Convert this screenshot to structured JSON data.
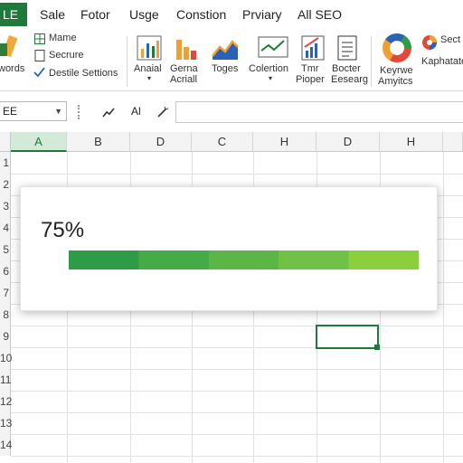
{
  "menubar": {
    "file_tab": "LE",
    "items": [
      "Sale",
      "Fotor",
      "Usge",
      "Constion",
      "Prviary",
      "All SEO"
    ]
  },
  "ribbon": {
    "left_label": "words",
    "group_items": [
      "Mame",
      "Secrure",
      "Destile Settions"
    ],
    "tools": [
      {
        "label": "Anaial",
        "sub": "▾",
        "icon": "line-chart-icon"
      },
      {
        "label": "Gerna",
        "sub": "Acriall",
        "icon": "bar-chart-icon"
      },
      {
        "label": "Toges",
        "sub": "",
        "icon": "area-chart-icon"
      },
      {
        "label": "Colertion",
        "sub": "▾",
        "icon": "trend-chart-icon"
      },
      {
        "label": "Tmr",
        "sub": "Pioper",
        "icon": "growth-chart-icon"
      },
      {
        "label": "Bocter",
        "sub": "Eesearg",
        "icon": "document-icon"
      },
      {
        "label": "Keyrwe",
        "sub": "Amyitcs",
        "icon": "donut-chart-icon"
      },
      {
        "label": "Kaphatate",
        "sub": "",
        "icon": "color-wheel-icon"
      }
    ],
    "sect_label": "Sect"
  },
  "formula_bar": {
    "name_box": "EE",
    "fx_label": "Al"
  },
  "grid": {
    "columns": [
      "A",
      "B",
      "D",
      "C",
      "H",
      "D",
      "H"
    ],
    "rows": [
      "1",
      "2",
      "3",
      "4",
      "5",
      "6",
      "7",
      "8",
      "9",
      "10",
      "11",
      "12",
      "13",
      "14"
    ]
  },
  "progress": {
    "label": "75%",
    "value": 1.0,
    "colors": [
      "#2e9b47",
      "#45ab47",
      "#5bb648",
      "#6fc245",
      "#8bd03c"
    ]
  },
  "colors": {
    "brand": "#1e7a3a",
    "active_header": "#d3ead8"
  }
}
